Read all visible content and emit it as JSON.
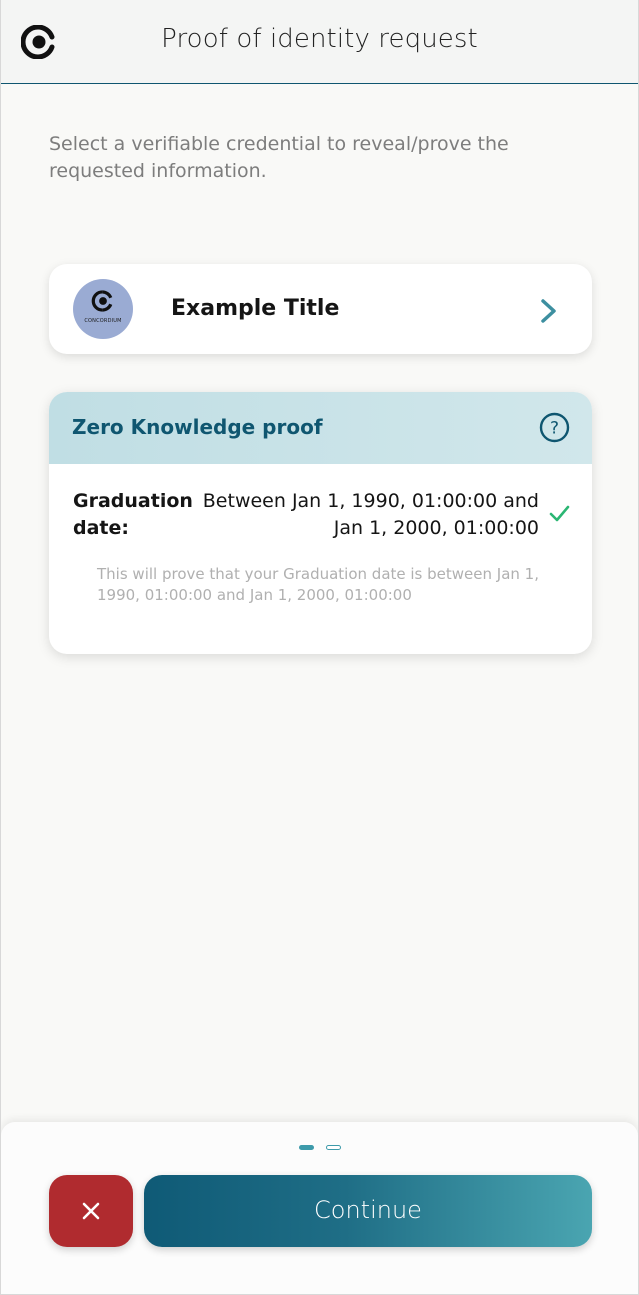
{
  "header": {
    "title": "Proof of identity request",
    "logo_icon": "concordium-logo-icon"
  },
  "instruction": "Select a verifiable credential to reveal/prove the requested information.",
  "credential": {
    "title": "Example Title",
    "avatar_text": "CONCORDIUM",
    "avatar_color": "#9aabd3",
    "chevron_icon": "chevron-right-icon"
  },
  "zk_proof": {
    "title": "Zero Knowledge proof",
    "help_icon": "question-circle-icon",
    "attribute_label": "Graduation date:",
    "attribute_value": "Between Jan 1, 1990, 01:00:00 and Jan 1, 2000, 01:00:00",
    "status_icon": "check-icon",
    "status_color": "#2bb673",
    "description": "This will prove that your Graduation date is between Jan 1, 1990, 01:00:00 and Jan 1, 2000, 01:00:00"
  },
  "pagination": {
    "current_page": 1,
    "total_pages": 2
  },
  "actions": {
    "reject_icon": "close-icon",
    "reject_color": "#b02b2f",
    "continue_label": "Continue",
    "accent_color": "#0f5670"
  }
}
